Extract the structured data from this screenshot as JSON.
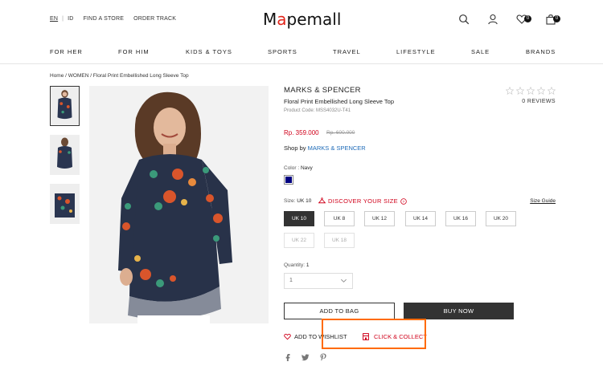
{
  "header": {
    "lang_en": "EN",
    "lang_sep": "|",
    "lang_id": "ID",
    "find_store": "FIND A STORE",
    "order_track": "ORDER TRACK",
    "logo": "Mapemall",
    "wishlist_count": "0",
    "cart_count": "0"
  },
  "nav": [
    "FOR HER",
    "FOR HIM",
    "KIDS & TOYS",
    "SPORTS",
    "TRAVEL",
    "LIFESTYLE",
    "SALE",
    "BRANDS"
  ],
  "breadcrumb": "Home / WOMEN / Floral Print Embellished Long Sleeve Top",
  "product": {
    "brand": "MARKS & SPENCER",
    "title": "Floral Print Embellished Long Sleeve Top",
    "code": "Product Code: MSS4032U-T41",
    "reviews": "0 REVIEWS",
    "price": "Rp. 359.000",
    "old_price": "Rp. 600.000",
    "shop_by_label": "Shop by",
    "shop_by_brand": "MARKS & SPENCER",
    "color_label": "Color :",
    "color_value": "Navy",
    "color_hex": "#000080",
    "size_label": "Size:",
    "size_value": "UK 10",
    "discover_size": "DISCOVER YOUR SIZE",
    "size_guide": "Size Guide",
    "sizes": [
      "UK 10",
      "UK 8",
      "UK 12",
      "UK 14",
      "UK 16",
      "UK 20",
      "UK 22",
      "UK 18"
    ],
    "quantity_label": "Quantity:",
    "quantity_value": "1",
    "quantity_select": "1",
    "add_to_bag": "ADD TO BAG",
    "buy_now": "BUY NOW",
    "add_to_wishlist": "ADD TO WISHLIST",
    "click_collect": "CLICK & COLLECT"
  },
  "colors": {
    "accent_red": "#d0021b",
    "link_blue": "#1e6bb8",
    "highlight_orange": "#ff6a00",
    "dark_button": "#333333"
  }
}
